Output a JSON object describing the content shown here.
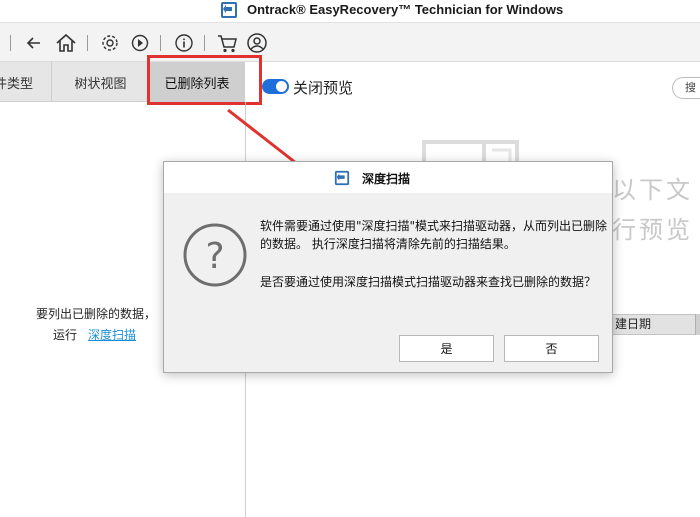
{
  "window": {
    "title": "Ontrack® EasyRecovery™ Technician for Windows"
  },
  "toolbar": {
    "icons": [
      "menu-separator",
      "back-icon",
      "home-icon",
      "settings-icon",
      "history-icon",
      "info-icon",
      "cart-icon",
      "user-icon"
    ]
  },
  "tabs": [
    {
      "label": "件类型",
      "active": false
    },
    {
      "label": "树状视图",
      "active": false
    },
    {
      "label": "已删除列表",
      "active": true
    }
  ],
  "preview": {
    "toggle_label": "关闭预览",
    "toggle_on": true,
    "search_label": "搜",
    "message_line1": "以下文",
    "message_line2": "行预览",
    "column_header": "建日期"
  },
  "left_panel": {
    "message_line1": "要列出已删除的数据，",
    "run_label": "运行",
    "deep_scan_link": "深度扫描"
  },
  "dialog": {
    "title": "深度扫描",
    "message1": "软件需要通过使用\"深度扫描\"模式来扫描驱动器，从而列出已删除的数据。 执行深度扫描将清除先前的扫描结果。",
    "message2": "是否要通过使用深度扫描模式扫描驱动器来查找已删除的数据？",
    "yes_label": "是",
    "no_label": "否"
  },
  "colors": {
    "highlight": "#e0322e",
    "toggle": "#1e6fd9",
    "link": "#1a8fd6"
  }
}
